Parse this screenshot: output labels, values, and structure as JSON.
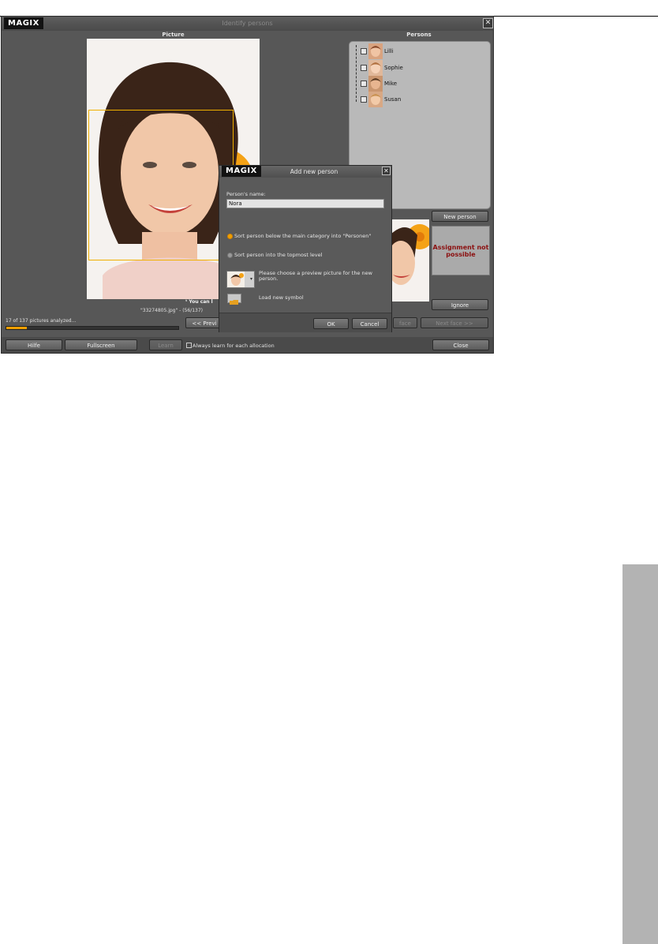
{
  "window": {
    "title": "Identify persons",
    "logo": "MAGIX",
    "close_glyph": "✕"
  },
  "picture_panel": {
    "heading": "Picture",
    "hint_text": "ᵗ You can l",
    "filename_text": "\"33274805.jpg\" - (56/137)",
    "progress_text": "17 of 137 pictures analyzed...",
    "progress_fraction": 0.12
  },
  "persons_panel": {
    "heading": "Persons",
    "persons": [
      {
        "name": "Lilli"
      },
      {
        "name": "Sophie"
      },
      {
        "name": "Mike"
      },
      {
        "name": "Susan"
      }
    ]
  },
  "right_controls": {
    "new_person_button": "New person",
    "assignment_text": "Assignment not possible",
    "ignore_button": "Ignore",
    "prev_face_button": "face",
    "next_face_button": "Next face >>"
  },
  "nav": {
    "prev_button": "<< Previ"
  },
  "bottom_bar": {
    "help_button": "Hilfe",
    "fullscreen_button": "Fullscreen",
    "learn_button": "Learn",
    "always_learn_label": "Always learn for each allocation",
    "close_button": "Close"
  },
  "dialog": {
    "logo": "MAGIX",
    "title": "Add new person",
    "close_glyph": "✕",
    "name_label": "Person's name:",
    "name_value": "Nora",
    "radio_sort_below": "Sort person below the main category into \"Personen\"",
    "radio_sort_top": "Sort person into the topmost level",
    "preview_text": "Please choose a preview picture for the new person.",
    "load_symbol_text": "Load new symbol",
    "ok_button": "OK",
    "cancel_button": "Cancel"
  },
  "colors": {
    "accent": "#f0a000",
    "warning": "#8c1010",
    "window_bg": "#575757"
  }
}
